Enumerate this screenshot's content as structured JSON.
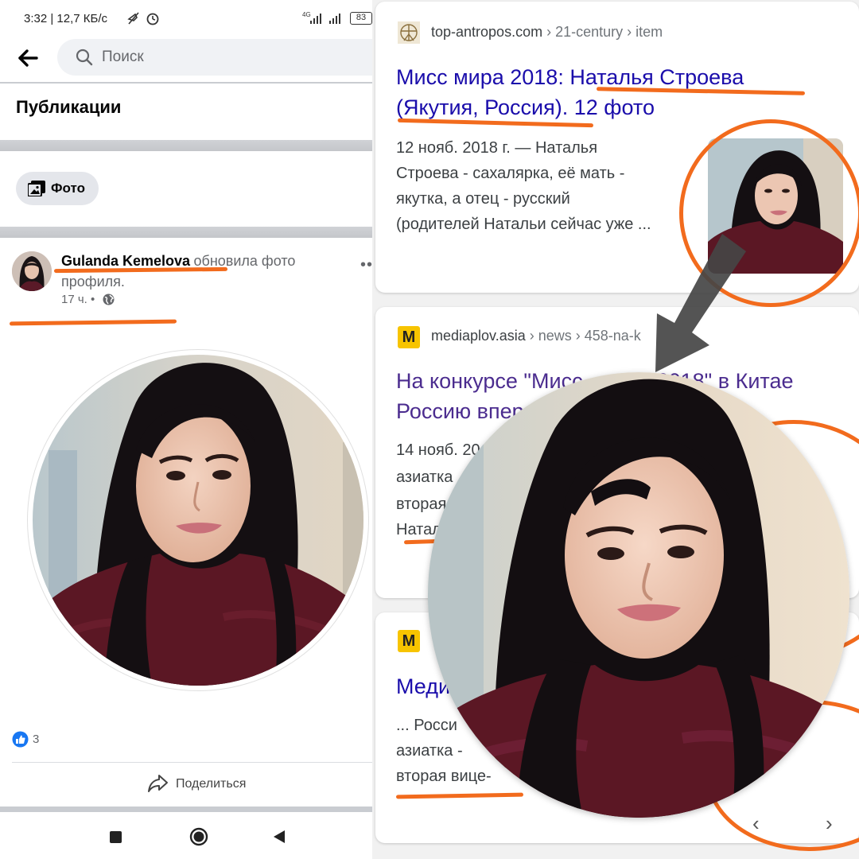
{
  "status_bar": {
    "time_speed": "3:32 | 12,7 КБ/с",
    "network": "4G",
    "battery": "83"
  },
  "search": {
    "placeholder": "Поиск"
  },
  "section": {
    "title": "Публикации"
  },
  "filter_chip": {
    "label": "Фото"
  },
  "post": {
    "author": "Gulanda Kemelova",
    "action_part1": "обновила фото",
    "action_part2": "профиля.",
    "time": "17 ч. •",
    "reactions_count": "3",
    "share_label": "Поделиться"
  },
  "results": [
    {
      "domain": "top-antropos.com",
      "path": " › 21-century › item",
      "title_line1": "Мисс мира 2018: Наталья Строева",
      "title_line2": "(Якутия, Россия). 12 фото",
      "snippet": [
        "12 нояб. 2018 г. — Наталья",
        "Строева - сахалярка, её мать -",
        "якутка, а отец - русский",
        "(родителей Натальи сейчас уже ..."
      ]
    },
    {
      "domain": "mediaplov.asia",
      "path": " › news › 458-na-k",
      "favicon": "M",
      "title_line1a": "На конкурсе \"Мисс",
      "title_line1b": "2018\" в Китае",
      "title_line2": "Россию впер",
      "snippet": [
        "14 нояб. 20",
        "азиатка",
        "вторая",
        "Натал"
      ]
    },
    {
      "favicon": "M",
      "title_line1": "Меди",
      "snippet": [
        "... Росси",
        "азиатка -",
        "вторая вице-"
      ]
    }
  ],
  "colors": {
    "highlight": "#f26b1d",
    "link_blue": "#1a0dab",
    "link_visited": "#4b2c8f",
    "chip_bg": "#e4e6eb"
  },
  "icons": {
    "back": "arrow-left-icon",
    "search": "search-icon",
    "photo": "photo-icon",
    "globe": "globe-icon",
    "like": "like-icon",
    "share": "share-icon",
    "nav_square": "recents-icon",
    "nav_circle": "home-icon",
    "nav_back": "back-triangle-icon"
  }
}
